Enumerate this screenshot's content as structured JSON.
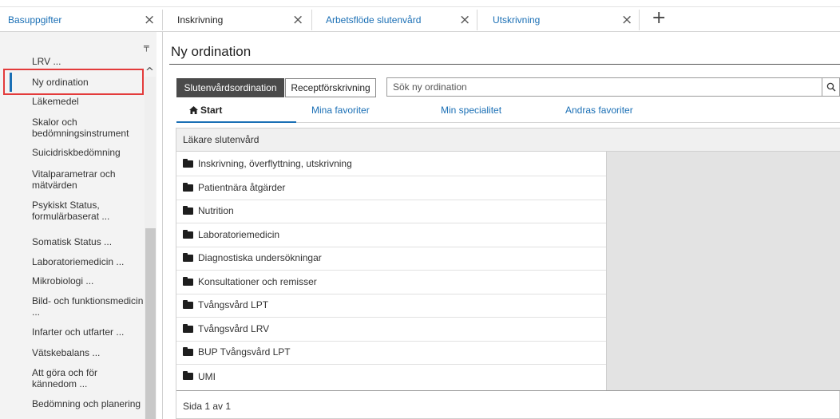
{
  "tabs": [
    {
      "label": "Basuppgifter",
      "close": "×"
    },
    {
      "label": "Inskrivning",
      "close": "×"
    },
    {
      "label": "Arbetsflöde slutenvård",
      "close": "×"
    },
    {
      "label": "Utskrivning",
      "close": "×"
    }
  ],
  "add_tab_label": "+",
  "sidebar": {
    "items": [
      "LRV ...",
      "Ny ordination",
      "Läkemedel",
      "Skalor och bedömningsinstrument",
      "Suicidriskbedömning",
      "Vitalparametrar och mätvärden",
      "Psykiskt Status, formulärbaserat ...",
      "Somatisk Status ...",
      "Laboratoriemedicin ...",
      "Mikrobiologi ...",
      "Bild- och funktionsmedicin ...",
      "Infarter och utfarter ...",
      "Vätskebalans ...",
      "Att göra och för kännedom ...",
      "Bedömning och planering"
    ]
  },
  "main": {
    "title": "Ny ordination",
    "buttons": {
      "primary": "Slutenvårdsordination",
      "secondary": "Receptförskrivning"
    },
    "search_placeholder": "Sök ny ordination",
    "subtabs": [
      "Start",
      "Mina favoriter",
      "Min specialitet",
      "Andras favoriter"
    ],
    "panel_header": "Läkare slutenvård",
    "folders": [
      "Inskrivning, överflyttning, utskrivning",
      "Patientnära åtgärder",
      "Nutrition",
      "Laboratoriemedicin",
      "Diagnostiska undersökningar",
      "Konsultationer och remisser",
      "Tvångsvård LPT",
      "Tvångsvård LRV",
      "BUP Tvångsvård LPT",
      "UMI"
    ],
    "pager": "Sida 1 av 1"
  },
  "colors": {
    "accent": "#1a6fb5",
    "highlight": "#e33b3b",
    "primary_button": "#4a4a4a"
  }
}
